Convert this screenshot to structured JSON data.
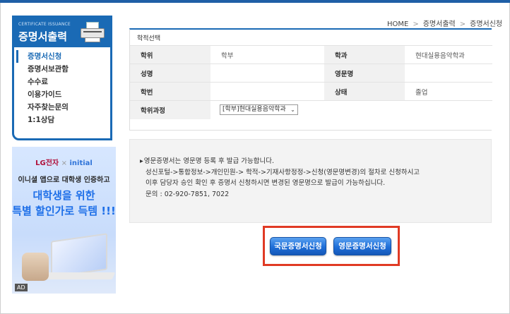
{
  "sidebar": {
    "subtitle": "CERTIFICATE ISSUANCE",
    "title": "증명서출력",
    "items": [
      {
        "label": "증명서신청",
        "active": true
      },
      {
        "label": "증명서보관함",
        "active": false
      },
      {
        "label": "수수료",
        "active": false
      },
      {
        "label": "이용가이드",
        "active": false
      },
      {
        "label": "자주찾는문의",
        "active": false
      },
      {
        "label": "1:1상담",
        "active": false
      }
    ]
  },
  "ad": {
    "brand_lg": "LG전자",
    "brand_x": "×",
    "brand_initial": "initial",
    "line1": "이니셜 앱으로 대학생 인증하고",
    "line2": "대학생을 위한",
    "line3": "특별 할인가로 득템 !!!",
    "badge": "AD"
  },
  "breadcrumb": {
    "home": "HOME",
    "sep": ">",
    "level1": "증명서출력",
    "level2": "증명서신청"
  },
  "form": {
    "section_title": "학적선택",
    "rows": [
      {
        "label1": "학위",
        "value1": "학부",
        "label2": "학과",
        "value2": "현대실용음악학과"
      },
      {
        "label1": "성명",
        "value1": "",
        "label2": "영문명",
        "value2": ""
      },
      {
        "label1": "학번",
        "value1": "",
        "label2": "상태",
        "value2": "졸업"
      }
    ],
    "course_label": "학위과정",
    "course_select": "[학부]현대실용음악학과"
  },
  "notice": {
    "lines": [
      "영문증명서는 영문명 등록 후 발급 가능합니다.",
      "성신포털->통합정보->개인민원-> 학적->기재사항정정->신청(영문명변경)의 절차로 신청하시고",
      "이후 담당자 승인 확인 후 증명서 신청하시면 변경된 영문명으로 발급이 가능하십니다.",
      "문의 : 02-920-7851, 7022"
    ]
  },
  "buttons": {
    "korean": "국문증명서신청",
    "english": "영문증명서신청"
  },
  "colors": {
    "brand_blue": "#1a6ab5",
    "highlight_red": "#e03a24",
    "button_blue": "#1e6ed8"
  }
}
